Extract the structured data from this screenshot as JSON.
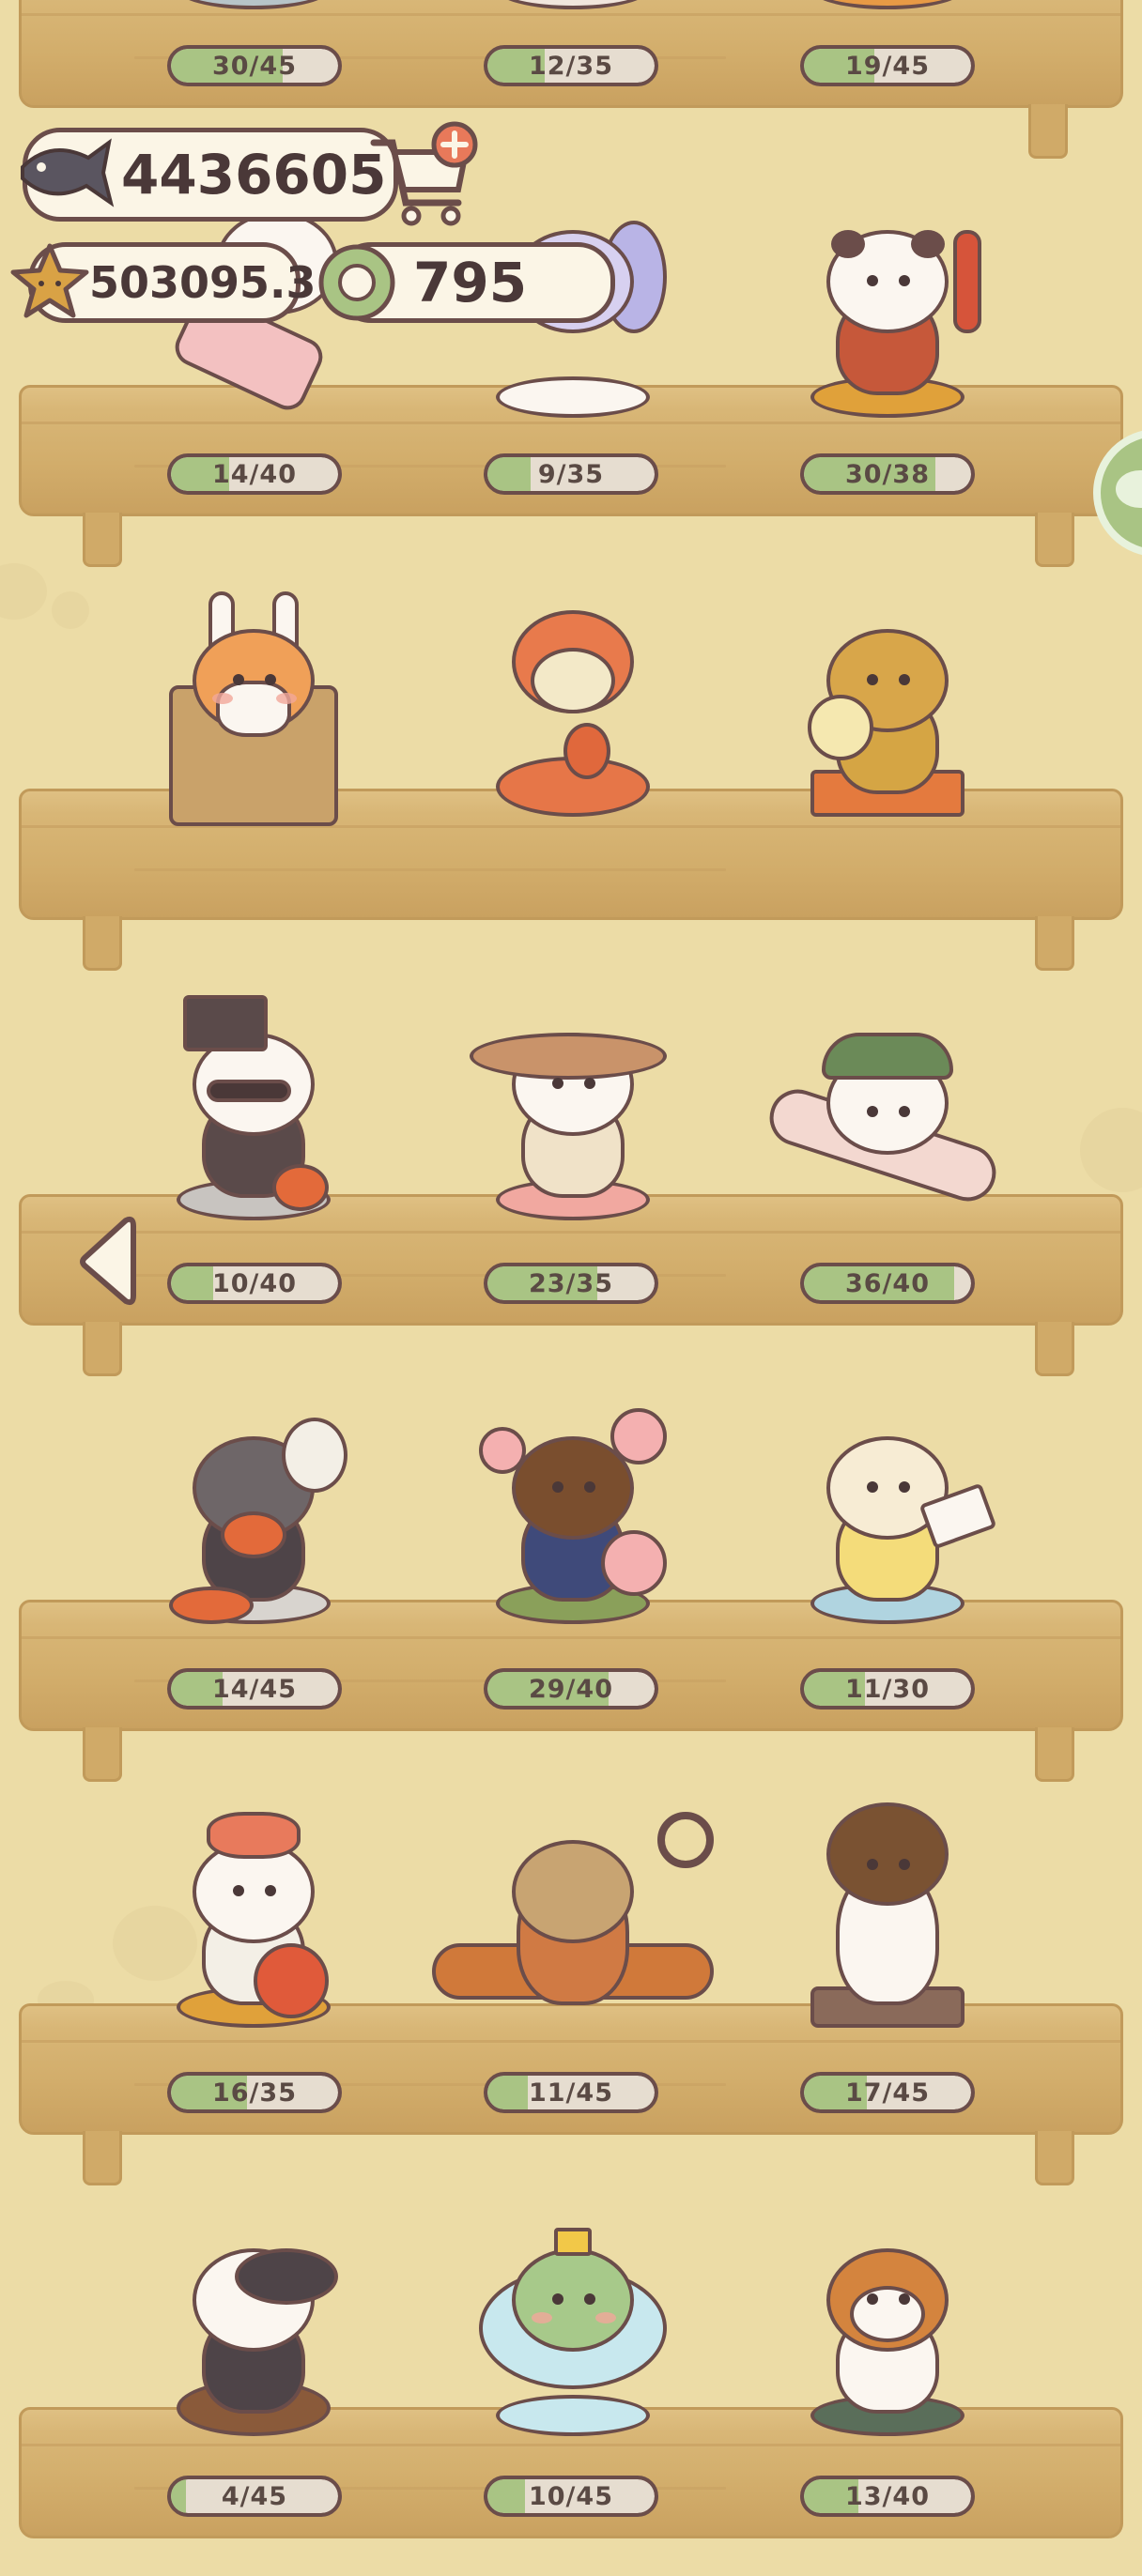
{
  "currency": {
    "fish": "4436605",
    "stars": "503095.3",
    "coins": "795"
  },
  "shelves": [
    {
      "bars": [
        {
          "label": "30/45",
          "ratio": 0.667
        },
        {
          "label": "12/35",
          "ratio": 0.343
        },
        {
          "label": "19/45",
          "ratio": 0.422
        }
      ]
    },
    {
      "bars": [
        {
          "label": "14/40",
          "ratio": 0.35
        },
        {
          "label": "9/35",
          "ratio": 0.257
        },
        {
          "label": "30/38",
          "ratio": 0.789
        }
      ]
    },
    {
      "bars": []
    },
    {
      "bars": [
        {
          "label": "10/40",
          "ratio": 0.25
        },
        {
          "label": "23/35",
          "ratio": 0.657
        },
        {
          "label": "36/40",
          "ratio": 0.9
        }
      ]
    },
    {
      "bars": [
        {
          "label": "14/45",
          "ratio": 0.311
        },
        {
          "label": "29/40",
          "ratio": 0.725
        },
        {
          "label": "11/30",
          "ratio": 0.367
        }
      ]
    },
    {
      "bars": [
        {
          "label": "16/35",
          "ratio": 0.457
        },
        {
          "label": "11/45",
          "ratio": 0.244
        },
        {
          "label": "17/45",
          "ratio": 0.378
        }
      ]
    },
    {
      "bars": [
        {
          "label": "4/45",
          "ratio": 0.089
        },
        {
          "label": "10/45",
          "ratio": 0.222
        },
        {
          "label": "13/40",
          "ratio": 0.325
        }
      ]
    }
  ],
  "colors": {
    "background": "#ecdca6",
    "shelf": "#d8b676",
    "bar_fill": "#a9c484",
    "outline": "#6b4d4a"
  },
  "icons": {
    "fish": "fish-icon",
    "cart": "shop-cart-icon",
    "star": "star-icon",
    "coin": "green-coin-icon",
    "back": "back-arrow-icon",
    "side": "chat-bubble-icon"
  }
}
